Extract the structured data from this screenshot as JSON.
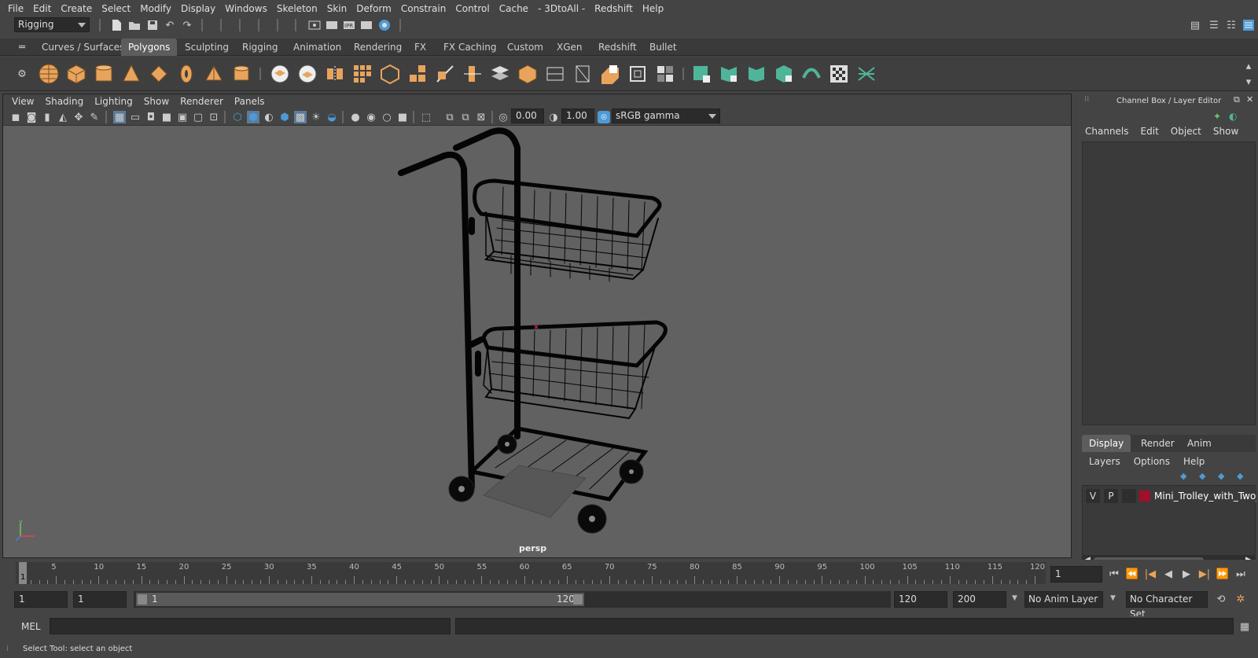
{
  "menubar": [
    "File",
    "Edit",
    "Create",
    "Select",
    "Modify",
    "Display",
    "Windows",
    "Skeleton",
    "Skin",
    "Deform",
    "Constrain",
    "Control",
    "Cache",
    "- 3DtoAll -",
    "Redshift",
    "Help"
  ],
  "status": {
    "menu_set": "Rigging"
  },
  "shelf_tabs": [
    "Curves / Surfaces",
    "Polygons",
    "Sculpting",
    "Rigging",
    "Animation",
    "Rendering",
    "FX",
    "FX Caching",
    "Custom",
    "XGen",
    "Redshift",
    "Bullet"
  ],
  "shelf_active": "Polygons",
  "viewport": {
    "menu": [
      "View",
      "Shading",
      "Lighting",
      "Show",
      "Renderer",
      "Panels"
    ],
    "exposure": "0.00",
    "gamma": "1.00",
    "color_space": "sRGB gamma",
    "camera_label": "persp"
  },
  "channel_box": {
    "title": "Channel Box / Layer Editor",
    "menu": [
      "Channels",
      "Edit",
      "Object",
      "Show"
    ],
    "tabs": [
      "Display",
      "Render",
      "Anim"
    ],
    "layer_menu": [
      "Layers",
      "Options",
      "Help"
    ],
    "layer": {
      "v": "V",
      "p": "P",
      "name": "Mini_Trolley_with_Two_E",
      "color": "#a0102a"
    }
  },
  "timeline": {
    "ticks": [
      "5",
      "10",
      "15",
      "20",
      "25",
      "30",
      "35",
      "40",
      "45",
      "50",
      "55",
      "60",
      "65",
      "70",
      "75",
      "80",
      "85",
      "90",
      "95",
      "100",
      "105",
      "110",
      "115",
      "120"
    ],
    "current_frame_marker": "1",
    "current_frame": "1"
  },
  "range": {
    "start": "1",
    "playback_start": "1",
    "slider_start": "1",
    "slider_end": "120",
    "playback_end": "120",
    "end": "200",
    "anim_layer": "No Anim Layer",
    "char_set": "No Character Set"
  },
  "cmd": {
    "lang": "MEL"
  },
  "help_line": "Select Tool: select an object",
  "colors": {
    "accent": "#4d9ad6",
    "shelf_orange": "#e8a45c",
    "shelf_teal": "#4fb59a"
  }
}
